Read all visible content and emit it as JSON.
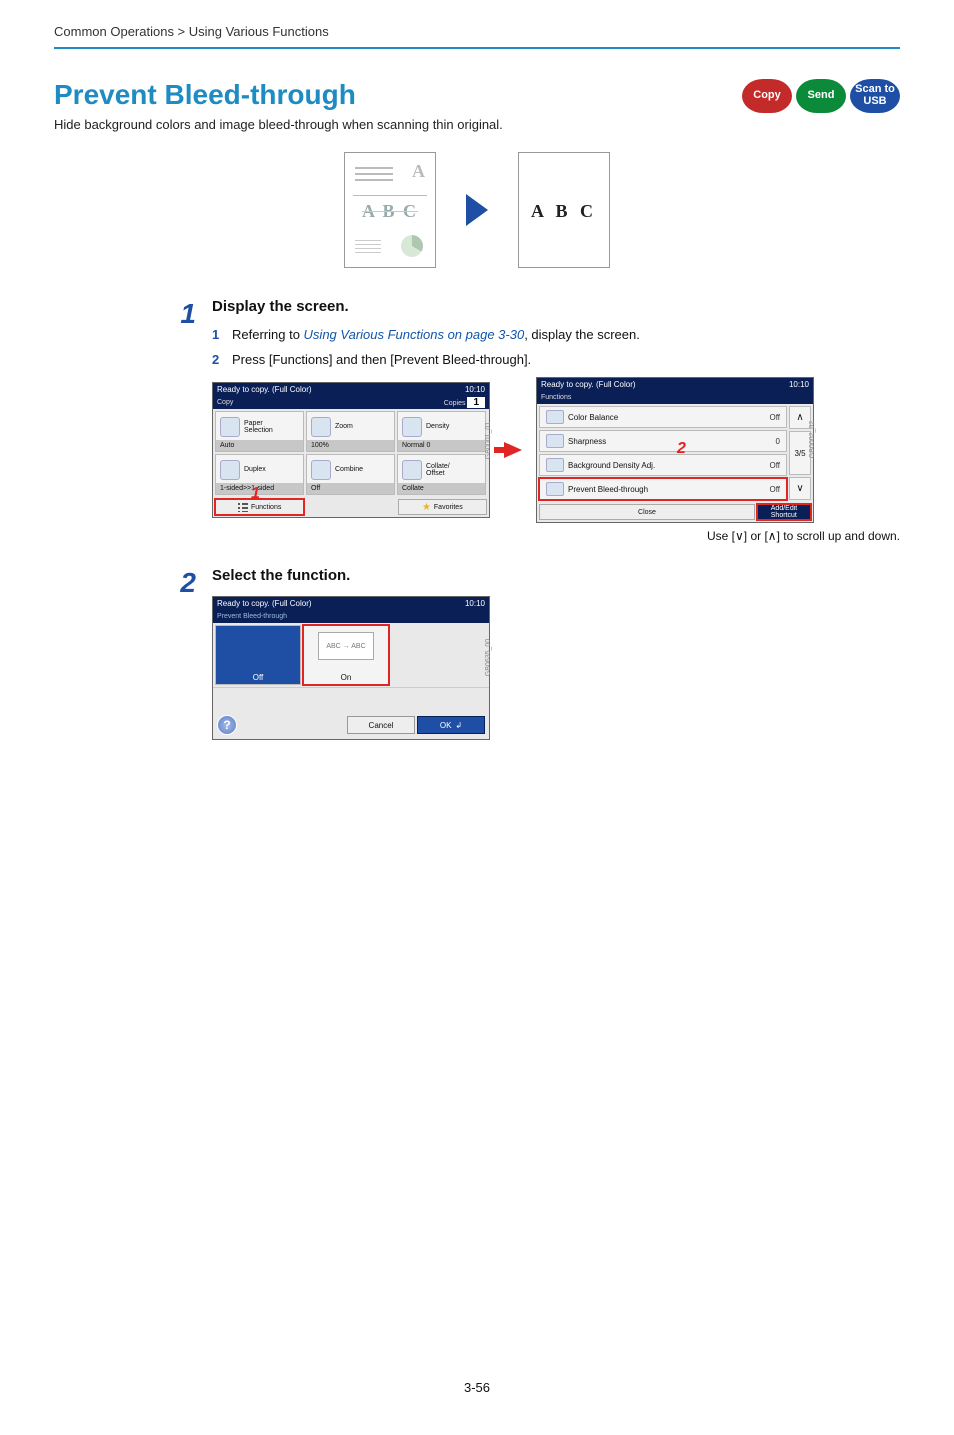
{
  "breadcrumb": "Common Operations > Using Various Functions",
  "title": "Prevent Bleed-through",
  "subtitle": "Hide background colors and image bleed-through when scanning thin original.",
  "modes": {
    "copy": "Copy",
    "send": "Send",
    "usb": "Scan to\nUSB"
  },
  "illustration": {
    "faded": "A B C",
    "clean": "A B C"
  },
  "step1": {
    "num": "1",
    "heading": "Display the screen.",
    "sub1_num": "1",
    "sub1_pre": "Referring to ",
    "sub1_link": "Using Various Functions on page 3-30",
    "sub1_post": ", display the screen.",
    "sub2_num": "2",
    "sub2_text": "Press [Functions] and then [Prevent Bleed-through]."
  },
  "copy_panel": {
    "status": "Ready to copy. (Full Color)",
    "time": "10:10",
    "subtab": "Copy",
    "copies_label": "Copies",
    "copies_value": "1",
    "tiles": [
      {
        "label": "Paper\nSelection",
        "bar": "Auto"
      },
      {
        "label": "Zoom",
        "bar": "100%"
      },
      {
        "label": "Density",
        "bar": "Normal 0"
      },
      {
        "label": "Duplex",
        "bar": "1-sided>>1-sided"
      },
      {
        "label": "Combine",
        "bar": "Off"
      },
      {
        "label": "Collate/\nOffset",
        "bar": "Collate"
      }
    ],
    "functions": "Functions",
    "favorites": "Favorites",
    "code": "GB0001_01",
    "red_num": "1"
  },
  "func_panel": {
    "status": "Ready to copy. (Full Color)",
    "time": "10:10",
    "subtab": "Functions",
    "rows": [
      {
        "label": "Color Balance",
        "val": "Off"
      },
      {
        "label": "Sharpness",
        "val": "0"
      },
      {
        "label": "Background Density Adj.",
        "val": "Off"
      },
      {
        "label": "Prevent Bleed-through",
        "val": "Off"
      }
    ],
    "page": "3/5",
    "close": "Close",
    "shortcut": "Add/Edit\nShortcut",
    "code": "GB0002_02",
    "red_num": "2",
    "note_pre": "Use [",
    "note_mid": "] or [",
    "note_post": "] to scroll up and down."
  },
  "step2": {
    "num": "2",
    "heading": "Select the function."
  },
  "prevent_panel": {
    "status": "Ready to copy. (Full Color)",
    "time": "10:10",
    "subtab": "Prevent Bleed-through",
    "off": "Off",
    "on": "On",
    "on_img": "ABC → ABC",
    "cancel": "Cancel",
    "ok": "OK",
    "help": "?",
    "code": "GB0635_00"
  },
  "page_num": "3-56"
}
